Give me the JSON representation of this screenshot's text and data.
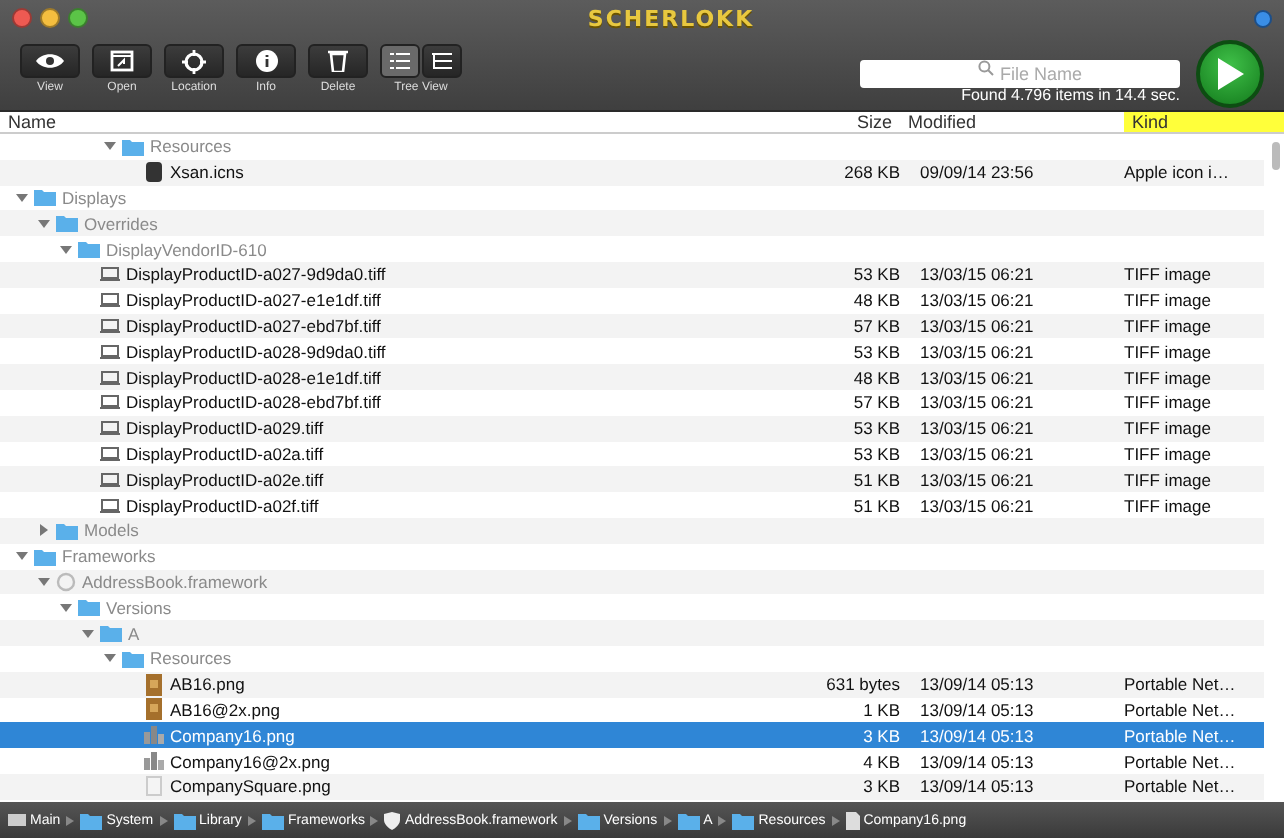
{
  "window": {
    "title": "SCHERLOKK"
  },
  "toolbar": {
    "buttons": [
      {
        "label": "View",
        "kind": "eye"
      },
      {
        "label": "Open",
        "kind": "open"
      },
      {
        "label": "Location",
        "kind": "target"
      },
      {
        "label": "Info",
        "kind": "info"
      },
      {
        "label": "Delete",
        "kind": "trash"
      }
    ],
    "view_toggle": {
      "label": "Tree View",
      "options": [
        {
          "kind": "list",
          "selected": true
        },
        {
          "kind": "tree",
          "selected": false
        }
      ]
    }
  },
  "search": {
    "placeholder": "File Name",
    "status": "Found 4.796 items in 14.4 sec."
  },
  "columns": [
    {
      "label": "Name",
      "sorted": false
    },
    {
      "label": "Size",
      "sorted": false
    },
    {
      "label": "Modified",
      "sorted": false
    },
    {
      "label": "Kind",
      "sorted": true
    }
  ],
  "partial_branch": [
    {
      "name": "Resources",
      "kind": "folder",
      "expanded": true,
      "selected": false,
      "children": [
        {
          "name": "Xsan.icns",
          "kind": "icns",
          "size": "268 KB",
          "modified": "09/09/14 23:56",
          "file_kind": "Apple icon i…",
          "selected": false
        }
      ]
    }
  ],
  "tree": [
    {
      "name": "Displays",
      "kind": "folder",
      "expanded": true,
      "selected": false,
      "children": [
        {
          "name": "Overrides",
          "kind": "folder",
          "expanded": true,
          "selected": false,
          "children": [
            {
              "name": "DisplayVendorID-610",
              "kind": "folder",
              "expanded": true,
              "selected": false,
              "children": [
                {
                  "name": "DisplayProductID-a027-9d9da0.tiff",
                  "kind": "tiff",
                  "size": "53 KB",
                  "modified": "13/03/15 06:21",
                  "file_kind": "TIFF image",
                  "selected": false
                },
                {
                  "name": "DisplayProductID-a027-e1e1df.tiff",
                  "kind": "tiff",
                  "size": "48 KB",
                  "modified": "13/03/15 06:21",
                  "file_kind": "TIFF image",
                  "selected": false
                },
                {
                  "name": "DisplayProductID-a027-ebd7bf.tiff",
                  "kind": "tiff",
                  "size": "57 KB",
                  "modified": "13/03/15 06:21",
                  "file_kind": "TIFF image",
                  "selected": false
                },
                {
                  "name": "DisplayProductID-a028-9d9da0.tiff",
                  "kind": "tiff",
                  "size": "53 KB",
                  "modified": "13/03/15 06:21",
                  "file_kind": "TIFF image",
                  "selected": false
                },
                {
                  "name": "DisplayProductID-a028-e1e1df.tiff",
                  "kind": "tiff",
                  "size": "48 KB",
                  "modified": "13/03/15 06:21",
                  "file_kind": "TIFF image",
                  "selected": false
                },
                {
                  "name": "DisplayProductID-a028-ebd7bf.tiff",
                  "kind": "tiff",
                  "size": "57 KB",
                  "modified": "13/03/15 06:21",
                  "file_kind": "TIFF image",
                  "selected": false
                },
                {
                  "name": "DisplayProductID-a029.tiff",
                  "kind": "tiff",
                  "size": "53 KB",
                  "modified": "13/03/15 06:21",
                  "file_kind": "TIFF image",
                  "selected": false
                },
                {
                  "name": "DisplayProductID-a02a.tiff",
                  "kind": "tiff",
                  "size": "53 KB",
                  "modified": "13/03/15 06:21",
                  "file_kind": "TIFF image",
                  "selected": false
                },
                {
                  "name": "DisplayProductID-a02e.tiff",
                  "kind": "tiff",
                  "size": "51 KB",
                  "modified": "13/03/15 06:21",
                  "file_kind": "TIFF image",
                  "selected": false
                },
                {
                  "name": "DisplayProductID-a02f.tiff",
                  "kind": "tiff",
                  "size": "51 KB",
                  "modified": "13/03/15 06:21",
                  "file_kind": "TIFF image",
                  "selected": false
                }
              ]
            }
          ]
        },
        {
          "name": "Models",
          "kind": "folder",
          "expanded": false,
          "selected": false
        }
      ]
    },
    {
      "name": "Frameworks",
      "kind": "folder",
      "expanded": true,
      "selected": false,
      "children": [
        {
          "name": "AddressBook.framework",
          "kind": "framework",
          "expanded": true,
          "selected": false,
          "children": [
            {
              "name": "Versions",
              "kind": "folder",
              "expanded": true,
              "selected": false,
              "children": [
                {
                  "name": "A",
                  "kind": "folder",
                  "expanded": true,
                  "selected": false,
                  "children": [
                    {
                      "name": "Resources",
                      "kind": "folder",
                      "expanded": true,
                      "selected": false,
                      "children": [
                        {
                          "name": "AB16.png",
                          "kind": "book",
                          "size": "631 bytes",
                          "modified": "13/09/14 05:13",
                          "file_kind": "Portable Net…",
                          "selected": false
                        },
                        {
                          "name": "AB16@2x.png",
                          "kind": "book",
                          "size": "1 KB",
                          "modified": "13/09/14 05:13",
                          "file_kind": "Portable Net…",
                          "selected": false
                        },
                        {
                          "name": "Company16.png",
                          "kind": "building",
                          "size": "3 KB",
                          "modified": "13/09/14 05:13",
                          "file_kind": "Portable Net…",
                          "selected": true
                        },
                        {
                          "name": "Company16@2x.png",
                          "kind": "building",
                          "size": "4 KB",
                          "modified": "13/09/14 05:13",
                          "file_kind": "Portable Net…",
                          "selected": false
                        },
                        {
                          "name": "CompanySquare.png",
                          "kind": "blank",
                          "size": "3 KB",
                          "modified": "13/09/14 05:13",
                          "file_kind": "Portable Net…",
                          "selected": false
                        }
                      ]
                    }
                  ]
                }
              ]
            }
          ]
        }
      ]
    }
  ],
  "breadcrumb": [
    {
      "label": "Main",
      "kind": "disk"
    },
    {
      "label": "System",
      "kind": "folder"
    },
    {
      "label": "Library",
      "kind": "folder"
    },
    {
      "label": "Frameworks",
      "kind": "folder"
    },
    {
      "label": "AddressBook.framework",
      "kind": "framework"
    },
    {
      "label": "Versions",
      "kind": "folder"
    },
    {
      "label": "A",
      "kind": "folder"
    },
    {
      "label": "Resources",
      "kind": "folder"
    },
    {
      "label": "Company16.png",
      "kind": "file"
    }
  ]
}
